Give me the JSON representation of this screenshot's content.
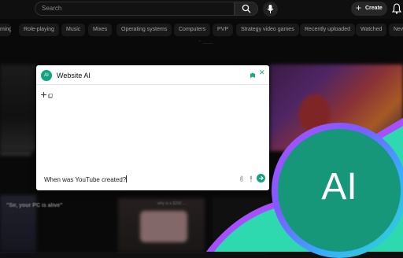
{
  "search": {
    "placeholder": "Search"
  },
  "header": {
    "create_label": "Create"
  },
  "chips": [
    "ming",
    "Role-playing",
    "Music",
    "Mixes",
    "Operating systems",
    "Computers",
    "PVP",
    "Strategy video games",
    "Recently uploaded",
    "Watched",
    "New"
  ],
  "background_text": {
    "small_label": "~ ____",
    "thumb_caption": "\"Sir, your PC is alive\"",
    "thumb_caption_2": "why is a $200 ..."
  },
  "widget": {
    "avatar": "AI",
    "title": "Website AI",
    "input_value": "When was YouTube created?",
    "accent": "#14a37f"
  },
  "badge": {
    "label": "AI",
    "color": "#16977a"
  },
  "icons": [
    "search-icon",
    "mic-icon",
    "plus-icon",
    "bell-icon",
    "pin-icon",
    "close-icon",
    "drag-icon",
    "copy-icon",
    "attach-icon",
    "mic-small-icon",
    "send-icon"
  ]
}
